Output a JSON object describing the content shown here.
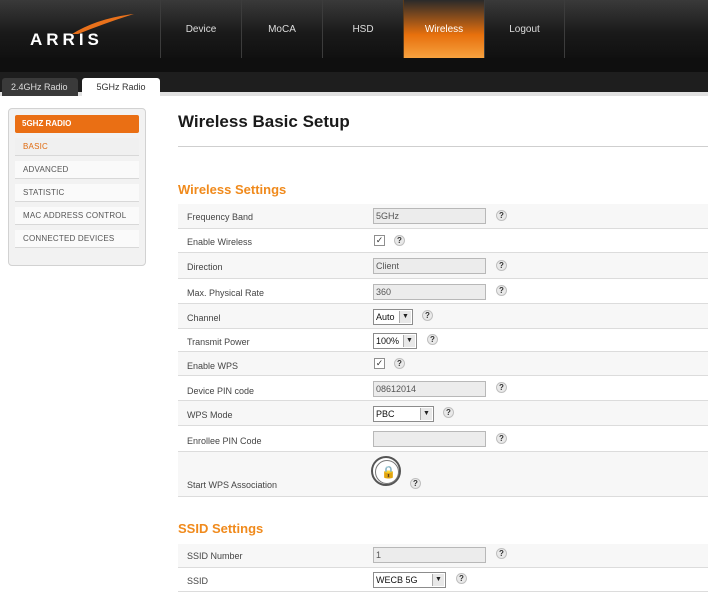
{
  "brand": "ARRIS",
  "nav": {
    "items": [
      "Device",
      "MoCA",
      "HSD",
      "Wireless",
      "Logout"
    ],
    "active": "Wireless"
  },
  "tabs": [
    "2.4GHz Radio",
    "5GHz Radio"
  ],
  "sidebar": {
    "heading": "5GHZ RADIO",
    "items": [
      "BASIC",
      "ADVANCED",
      "STATISTIC",
      "MAC ADDRESS CONTROL",
      "CONNECTED DEVICES"
    ],
    "active": "BASIC"
  },
  "page_title": "Wireless Basic Setup",
  "wireless_settings": {
    "title": "Wireless Settings",
    "frequency_band": {
      "label": "Frequency Band",
      "value": "5GHz"
    },
    "enable_wireless": {
      "label": "Enable Wireless",
      "checked": "✓"
    },
    "direction": {
      "label": "Direction",
      "value": "Client"
    },
    "max_rate": {
      "label": "Max. Physical Rate",
      "value": "360"
    },
    "channel": {
      "label": "Channel",
      "value": "Auto"
    },
    "transmit_power": {
      "label": "Transmit Power",
      "value": "100%"
    },
    "enable_wps": {
      "label": "Enable WPS",
      "checked": "✓"
    },
    "device_pin": {
      "label": "Device PIN code",
      "value": "08612014"
    },
    "wps_mode": {
      "label": "WPS Mode",
      "value": "PBC"
    },
    "enrollee_pin": {
      "label": "Enrollee PIN Code",
      "value": ""
    },
    "start_wps": {
      "label": "Start WPS Association"
    }
  },
  "ssid_settings": {
    "title": "SSID Settings",
    "ssid_number": {
      "label": "SSID Number",
      "value": "1"
    },
    "ssid": {
      "label": "SSID",
      "value": "WECB 5G"
    }
  },
  "help_glyph": "?",
  "lock_glyph": "🔒",
  "dropdown_arrow": "▼",
  "colors": {
    "accent": "#f08a1c",
    "header": "#111111"
  }
}
